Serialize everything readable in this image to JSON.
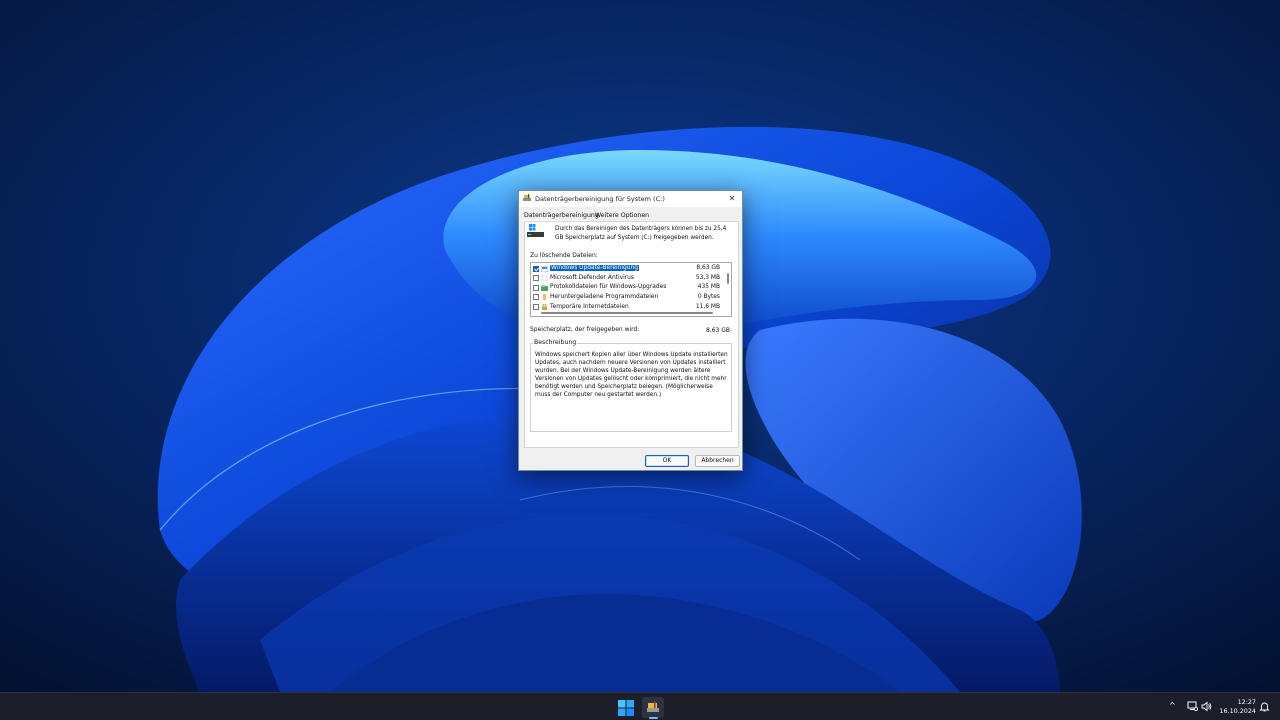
{
  "dialog": {
    "title": "Datenträgerbereinigung für System (C:)",
    "tabs": [
      {
        "label": "Datenträgerbereinigung"
      },
      {
        "label": "Weitere Optionen"
      }
    ],
    "intro": "Durch das Bereinigen des Datenträgers können bis zu 25,4 GB Speicherplatz auf System (C:) freigegeben werden.",
    "list_label": "Zu löschende Dateien:",
    "files": [
      {
        "name": "Windows Update-Bereinigung",
        "size": "8,63 GB",
        "checked": true,
        "selected": true,
        "icon": "windows-update-icon"
      },
      {
        "name": "Microsoft Defender Antivirus",
        "size": "53,3 MB",
        "checked": false,
        "selected": false,
        "icon": "blank-file-icon"
      },
      {
        "name": "Protokolldateien für Windows-Upgrades",
        "size": "435 MB",
        "checked": false,
        "selected": false,
        "icon": "log-files-icon"
      },
      {
        "name": "Heruntergeladene Programmdateien",
        "size": "0 Bytes",
        "checked": false,
        "selected": false,
        "icon": "folder-icon"
      },
      {
        "name": "Temporäre Internetdateien",
        "size": "11,6 MB",
        "checked": false,
        "selected": false,
        "icon": "lock-icon"
      }
    ],
    "space_label": "Speicherplatz, der freigegeben wird:",
    "space_value": "8,63 GB",
    "description_label": "Beschreibung",
    "description": "Windows speichert Kopien aller über Windows Update installierten Updates, auch nachdem neuere Versionen von Updates installiert wurden. Bei der Windows Update-Bereinigung werden ältere Versionen von Updates gelöscht oder komprimiert, die nicht mehr benötigt werden und Speicherplatz belegen. (Möglicherweise muss der Computer neu gestartet werden.)",
    "ok_label": "OK",
    "cancel_label": "Abbrechen",
    "close_glyph": "✕"
  },
  "taskbar": {
    "chevron_glyph": "^",
    "time": "12:27",
    "date": "16.10.2024"
  },
  "colors": {
    "selection": "#0a64c9",
    "accent": "#1a5fb4",
    "taskbar": "#1c1f2a"
  }
}
